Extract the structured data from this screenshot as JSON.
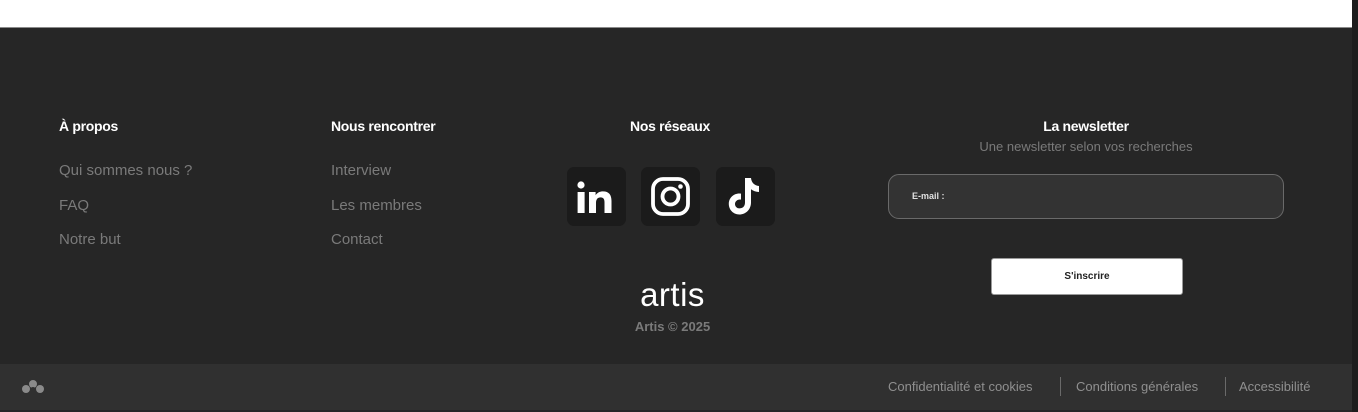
{
  "about": {
    "title": "À propos",
    "links": [
      "Qui sommes nous ?",
      "FAQ",
      "Notre but"
    ]
  },
  "meet": {
    "title": "Nous rencontrer",
    "links": [
      "Interview",
      "Les membres",
      "Contact"
    ]
  },
  "social": {
    "title": "Nos réseaux",
    "icons": [
      "linkedin-icon",
      "instagram-icon",
      "tiktok-icon"
    ]
  },
  "brand": {
    "logo_text": "artis",
    "copyright": "Artis © 2025"
  },
  "newsletter": {
    "title": "La newsletter",
    "subtitle": "Une newsletter selon vos recherches",
    "email_label": "E-mail :",
    "email_value": "",
    "subscribe_label": "S'inscrire"
  },
  "legal": {
    "links": [
      "Confidentialité et cookies",
      "Conditions générales",
      "Accessibilité"
    ]
  },
  "colors": {
    "background": "#262626",
    "bottom_bar": "#303030",
    "link_gray": "#7a7a7a",
    "social_tile": "#1b1b1b"
  }
}
